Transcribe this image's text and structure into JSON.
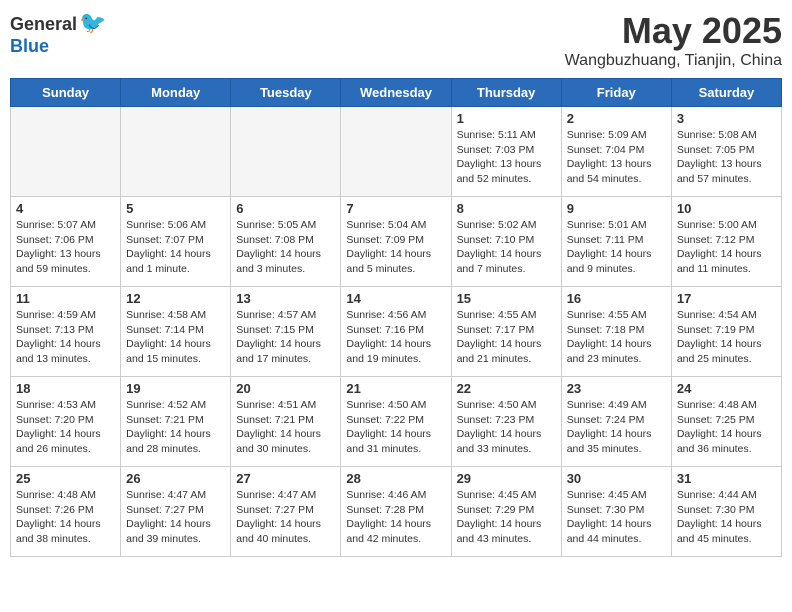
{
  "logo": {
    "general": "General",
    "blue": "Blue"
  },
  "title": "May 2025",
  "subtitle": "Wangbuzhuang, Tianjin, China",
  "weekdays": [
    "Sunday",
    "Monday",
    "Tuesday",
    "Wednesday",
    "Thursday",
    "Friday",
    "Saturday"
  ],
  "weeks": [
    [
      {
        "day": "",
        "info": ""
      },
      {
        "day": "",
        "info": ""
      },
      {
        "day": "",
        "info": ""
      },
      {
        "day": "",
        "info": ""
      },
      {
        "day": "1",
        "info": "Sunrise: 5:11 AM\nSunset: 7:03 PM\nDaylight: 13 hours\nand 52 minutes."
      },
      {
        "day": "2",
        "info": "Sunrise: 5:09 AM\nSunset: 7:04 PM\nDaylight: 13 hours\nand 54 minutes."
      },
      {
        "day": "3",
        "info": "Sunrise: 5:08 AM\nSunset: 7:05 PM\nDaylight: 13 hours\nand 57 minutes."
      }
    ],
    [
      {
        "day": "4",
        "info": "Sunrise: 5:07 AM\nSunset: 7:06 PM\nDaylight: 13 hours\nand 59 minutes."
      },
      {
        "day": "5",
        "info": "Sunrise: 5:06 AM\nSunset: 7:07 PM\nDaylight: 14 hours\nand 1 minute."
      },
      {
        "day": "6",
        "info": "Sunrise: 5:05 AM\nSunset: 7:08 PM\nDaylight: 14 hours\nand 3 minutes."
      },
      {
        "day": "7",
        "info": "Sunrise: 5:04 AM\nSunset: 7:09 PM\nDaylight: 14 hours\nand 5 minutes."
      },
      {
        "day": "8",
        "info": "Sunrise: 5:02 AM\nSunset: 7:10 PM\nDaylight: 14 hours\nand 7 minutes."
      },
      {
        "day": "9",
        "info": "Sunrise: 5:01 AM\nSunset: 7:11 PM\nDaylight: 14 hours\nand 9 minutes."
      },
      {
        "day": "10",
        "info": "Sunrise: 5:00 AM\nSunset: 7:12 PM\nDaylight: 14 hours\nand 11 minutes."
      }
    ],
    [
      {
        "day": "11",
        "info": "Sunrise: 4:59 AM\nSunset: 7:13 PM\nDaylight: 14 hours\nand 13 minutes."
      },
      {
        "day": "12",
        "info": "Sunrise: 4:58 AM\nSunset: 7:14 PM\nDaylight: 14 hours\nand 15 minutes."
      },
      {
        "day": "13",
        "info": "Sunrise: 4:57 AM\nSunset: 7:15 PM\nDaylight: 14 hours\nand 17 minutes."
      },
      {
        "day": "14",
        "info": "Sunrise: 4:56 AM\nSunset: 7:16 PM\nDaylight: 14 hours\nand 19 minutes."
      },
      {
        "day": "15",
        "info": "Sunrise: 4:55 AM\nSunset: 7:17 PM\nDaylight: 14 hours\nand 21 minutes."
      },
      {
        "day": "16",
        "info": "Sunrise: 4:55 AM\nSunset: 7:18 PM\nDaylight: 14 hours\nand 23 minutes."
      },
      {
        "day": "17",
        "info": "Sunrise: 4:54 AM\nSunset: 7:19 PM\nDaylight: 14 hours\nand 25 minutes."
      }
    ],
    [
      {
        "day": "18",
        "info": "Sunrise: 4:53 AM\nSunset: 7:20 PM\nDaylight: 14 hours\nand 26 minutes."
      },
      {
        "day": "19",
        "info": "Sunrise: 4:52 AM\nSunset: 7:21 PM\nDaylight: 14 hours\nand 28 minutes."
      },
      {
        "day": "20",
        "info": "Sunrise: 4:51 AM\nSunset: 7:21 PM\nDaylight: 14 hours\nand 30 minutes."
      },
      {
        "day": "21",
        "info": "Sunrise: 4:50 AM\nSunset: 7:22 PM\nDaylight: 14 hours\nand 31 minutes."
      },
      {
        "day": "22",
        "info": "Sunrise: 4:50 AM\nSunset: 7:23 PM\nDaylight: 14 hours\nand 33 minutes."
      },
      {
        "day": "23",
        "info": "Sunrise: 4:49 AM\nSunset: 7:24 PM\nDaylight: 14 hours\nand 35 minutes."
      },
      {
        "day": "24",
        "info": "Sunrise: 4:48 AM\nSunset: 7:25 PM\nDaylight: 14 hours\nand 36 minutes."
      }
    ],
    [
      {
        "day": "25",
        "info": "Sunrise: 4:48 AM\nSunset: 7:26 PM\nDaylight: 14 hours\nand 38 minutes."
      },
      {
        "day": "26",
        "info": "Sunrise: 4:47 AM\nSunset: 7:27 PM\nDaylight: 14 hours\nand 39 minutes."
      },
      {
        "day": "27",
        "info": "Sunrise: 4:47 AM\nSunset: 7:27 PM\nDaylight: 14 hours\nand 40 minutes."
      },
      {
        "day": "28",
        "info": "Sunrise: 4:46 AM\nSunset: 7:28 PM\nDaylight: 14 hours\nand 42 minutes."
      },
      {
        "day": "29",
        "info": "Sunrise: 4:45 AM\nSunset: 7:29 PM\nDaylight: 14 hours\nand 43 minutes."
      },
      {
        "day": "30",
        "info": "Sunrise: 4:45 AM\nSunset: 7:30 PM\nDaylight: 14 hours\nand 44 minutes."
      },
      {
        "day": "31",
        "info": "Sunrise: 4:44 AM\nSunset: 7:30 PM\nDaylight: 14 hours\nand 45 minutes."
      }
    ]
  ]
}
